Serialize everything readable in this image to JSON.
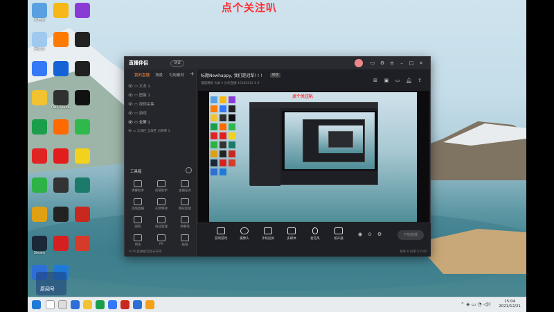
{
  "overlay_title": "点个关注叭",
  "desktop_icons": [
    {
      "label": "此电脑",
      "color": "#5aa0e0",
      "icon": "computer-icon"
    },
    {
      "label": "",
      "color": "#f5b818",
      "icon": "app-icon"
    },
    {
      "label": "",
      "color": "#8a3bd6",
      "icon": "app-icon"
    },
    {
      "label": "回收站",
      "color": "#9fc9ef",
      "icon": "recycle-bin-icon"
    },
    {
      "label": "",
      "color": "#ff7a00",
      "icon": "app-icon"
    },
    {
      "label": "",
      "color": "#222222",
      "icon": "app-icon"
    },
    {
      "label": "",
      "color": "#3478f6",
      "icon": "app-icon"
    },
    {
      "label": "",
      "color": "#1463d6",
      "icon": "app-icon"
    },
    {
      "label": "",
      "color": "#202020",
      "icon": "app-icon"
    },
    {
      "label": "",
      "color": "#f2c230",
      "icon": "folder-icon"
    },
    {
      "label": "OBS Studio",
      "color": "#303030",
      "icon": "obs-icon"
    },
    {
      "label": "",
      "color": "#111111",
      "icon": "capcut-icon"
    },
    {
      "label": "",
      "color": "#1a9e4a",
      "icon": "edge-icon"
    },
    {
      "label": "",
      "color": "#ff6a00",
      "icon": "app-icon"
    },
    {
      "label": "",
      "color": "#2fb84c",
      "icon": "app-icon"
    },
    {
      "label": "",
      "color": "#e02424",
      "icon": "app-icon"
    },
    {
      "label": "",
      "color": "#e31d1d",
      "icon": "music-icon"
    },
    {
      "label": "",
      "color": "#f2d21d",
      "icon": "app-icon"
    },
    {
      "label": "",
      "color": "#2db245",
      "icon": "wechat-icon"
    },
    {
      "label": "",
      "color": "#333333",
      "icon": "app-icon"
    },
    {
      "label": "",
      "color": "#1b7a6a",
      "icon": "app-icon"
    },
    {
      "label": "",
      "color": "#e0a014",
      "icon": "app-icon"
    },
    {
      "label": "",
      "color": "#222222",
      "icon": "game-icon"
    },
    {
      "label": "",
      "color": "#c8281e",
      "icon": "app-icon"
    },
    {
      "label": "Steam",
      "color": "#1b2838",
      "icon": "steam-icon"
    },
    {
      "label": "",
      "color": "#d62020",
      "icon": "app-icon"
    },
    {
      "label": "",
      "color": "#d63a2a",
      "icon": "app-icon"
    },
    {
      "label": "",
      "color": "#2d6fd6",
      "icon": "app-icon"
    },
    {
      "label": "",
      "color": "#1e7ad6",
      "icon": "app-icon"
    }
  ],
  "watermark": "原阅号",
  "app": {
    "logo": "直播伴侣",
    "version_badge": "测试",
    "tabs": [
      "我的直播",
      "场景",
      "可用素材"
    ],
    "scenes": [
      "文本 1",
      "图像 1",
      "视频采集",
      "游戏",
      "全屏 1",
      "工具栏 全屏区 分辨率 1"
    ],
    "tools_label": "工具箱",
    "tools": [
      "弹幕助手",
      "房管助手",
      "主播任务",
      "连线直播",
      "礼物特效",
      "精彩回放",
      "团购",
      "商品管理",
      "弹幕墙",
      "更多",
      "PK",
      "贴纸"
    ],
    "room_title": "标题Newhappy, 我们是冠军! ! !",
    "room_badge": "修改",
    "meta": "电脑横屏   大屏 ▾   分享直播   10183412   0   0",
    "canvas_title": "点个关注叭",
    "controls": [
      "游戏游戏",
      "摄像头",
      "手机投屏",
      "多媒体",
      "麦克风",
      "扬声器"
    ],
    "golive": "开始直播",
    "status_left": "0.0%直播推流暂未开始",
    "status_right": "帧率:0   码率:0   0:00"
  },
  "taskbar": {
    "time": "15:04",
    "date": "2021/12/21"
  }
}
